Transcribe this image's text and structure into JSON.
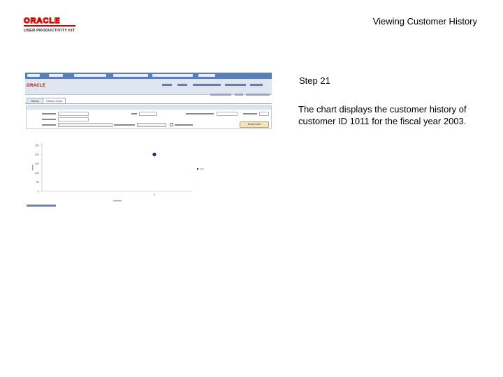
{
  "header": {
    "brand": "ORACLE",
    "brand_sub": "USER PRODUCTIVITY KIT",
    "title": "Viewing Customer History"
  },
  "step": {
    "label": "Step 21",
    "text": "The chart displays the customer history of customer ID 1011 for the fiscal year 2003."
  },
  "screenshot": {
    "app_logo": "ORACLE",
    "tabs": [
      "History",
      "History Chart"
    ],
    "active_tab": "History Chart",
    "chart_button": "Draw Chart",
    "colors": {
      "nav": "#5a7fb3",
      "header": "#dfe6f0",
      "button": "#f4e3bf",
      "point": "#1a2d8c"
    }
  },
  "chart_data": {
    "type": "scatter",
    "y_ticks": [
      250,
      200,
      150,
      100,
      50,
      0
    ],
    "ylim": [
      0,
      250
    ],
    "x_ticks": [
      "0"
    ],
    "points": [
      {
        "x": 0,
        "y": 200
      }
    ],
    "grid": false,
    "legend": "right"
  }
}
